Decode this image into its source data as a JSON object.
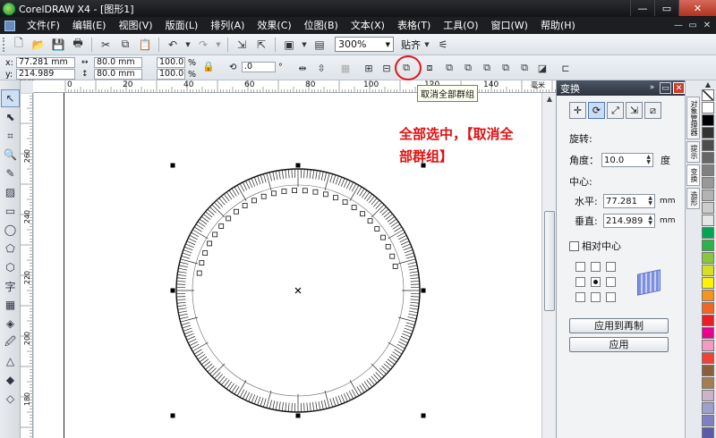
{
  "window": {
    "title": "CorelDRAW X4 - [图形1]",
    "buttons": [
      "—",
      "▭",
      "✕"
    ]
  },
  "menu": {
    "items": [
      "文件(F)",
      "编辑(E)",
      "视图(V)",
      "版面(L)",
      "排列(A)",
      "效果(C)",
      "位图(B)",
      "文本(X)",
      "表格(T)",
      "工具(O)",
      "窗口(W)",
      "帮助(H)"
    ],
    "right": [
      "—",
      "▭",
      "✕"
    ]
  },
  "toolbar": {
    "zoom": "300%",
    "snap": "贴齐"
  },
  "propbar": {
    "x_label": "x:",
    "x_value": "77.281 mm",
    "y_label": "y:",
    "y_value": "214.989 mm",
    "w_value": "80.0 mm",
    "h_value": "80.0 mm",
    "scale_x": "100.0",
    "scale_y": "100.0",
    "pct": "%",
    "rotate": ".0",
    "degree": "°"
  },
  "tooltip": "取消全部群组",
  "annotation": {
    "line1": "全部选中，【取消全",
    "line2": "部群组】"
  },
  "ruler": {
    "top_labels": [
      "0",
      "20",
      "40",
      "60",
      "80",
      "100",
      "120",
      "140"
    ],
    "units": "毫米",
    "left_labels": [
      "260",
      "240",
      "220",
      "200",
      "180"
    ]
  },
  "docker": {
    "title": "变换",
    "rotate_heading": "旋转:",
    "angle_label": "角度：",
    "angle_value": "10.0",
    "angle_unit": "度",
    "center_heading": "中心:",
    "h_label": "水平:",
    "h_value": "77.281",
    "v_label": "垂直:",
    "v_value": "214.989",
    "mm": "mm",
    "relative_center": "相对中心",
    "apply_dup": "应用到再制",
    "apply": "应用"
  },
  "sidetabs": [
    "对象管理器",
    "提示",
    "变换",
    "造形"
  ],
  "palette": {
    "colors": [
      "#ffffff",
      "#000000",
      "#333333",
      "#4d4d4d",
      "#666666",
      "#808080",
      "#999999",
      "#b3b3b3",
      "#cccccc",
      "#e6e6e6",
      "#00a651",
      "#2bb34a",
      "#8cc63f",
      "#d7df23",
      "#fff200",
      "#f7941d",
      "#f26522",
      "#ed1c24",
      "#ec008c",
      "#f49ac1",
      "#ef4136",
      "#8b5e3c",
      "#a67c52",
      "#ccb3cc",
      "#9e9ecf",
      "#8080c0",
      "#5b5ba8",
      "#2e3192"
    ]
  }
}
